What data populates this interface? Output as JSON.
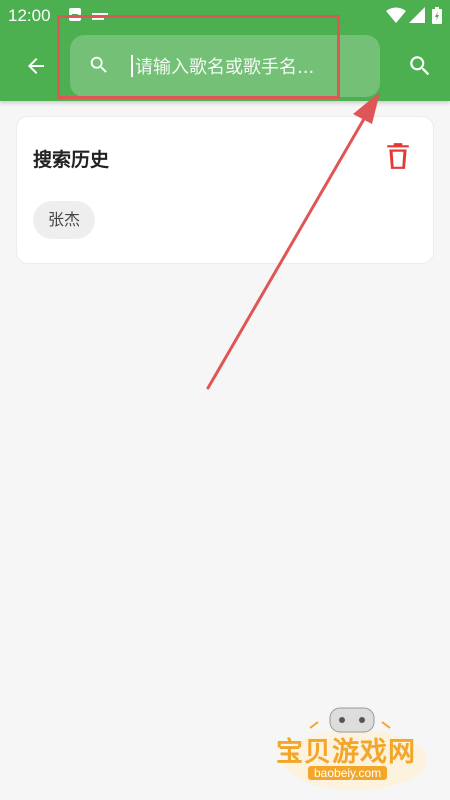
{
  "status_bar": {
    "time": "12:00",
    "icons": [
      "notification-icon",
      "sim-icon",
      "wifi-icon",
      "signal-icon",
      "battery-icon"
    ]
  },
  "header": {
    "back_icon": "arrow-back-icon",
    "search": {
      "placeholder": "请输入歌名或歌手名...",
      "icon": "search-icon"
    },
    "action_icon": "search-icon",
    "background_color": "#4caf50"
  },
  "history": {
    "title": "搜索历史",
    "clear_icon": "trash-icon",
    "clear_icon_color": "#e53935",
    "items": [
      "张杰"
    ]
  },
  "watermark": {
    "name": "宝贝游戏网",
    "domain": "baobeiy.com"
  },
  "annotation_color": "#e05555"
}
